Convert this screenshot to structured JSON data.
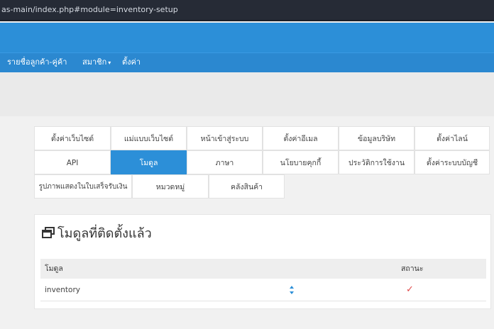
{
  "browser": {
    "url": "as-main/index.php#module=inventory-setup"
  },
  "nav": {
    "items": [
      {
        "label": "รายชื่อลูกค้า-คู่ค้า"
      },
      {
        "label": "สมาชิก"
      },
      {
        "label": "ตั้งค่า"
      }
    ],
    "caret": "▾"
  },
  "tabs": {
    "row1": [
      "ตั้งค่าเว็บไซต์",
      "แม่แบบเว็บไซต์",
      "หน้าเข้าสู่ระบบ",
      "ตั้งค่าอีเมล",
      "ข้อมูลบริษัท",
      "ตั้งค่าไลน์"
    ],
    "row2": [
      "API",
      "โมดูล",
      "ภาษา",
      "นโยบายคุกกี้",
      "ประวัติการใช้งาน",
      "ตั้งค่าระบบบัญชี"
    ],
    "row3": [
      "รูปภาพแสดงในใบเสร็จรับเงิน",
      "หมวดหมู่",
      "คลังสินค้า"
    ],
    "active": "โมดูล"
  },
  "panel": {
    "title": "โมดูลที่ติดตั้งแล้ว",
    "icon": "windows-icon",
    "columns": {
      "module": "โมดูล",
      "status": "สถานะ"
    },
    "rows": [
      {
        "name": "inventory",
        "status_icon": "✓"
      }
    ]
  },
  "colors": {
    "primary": "#2c8fd8",
    "urlbar": "#262b36",
    "check": "#e04a4a"
  }
}
